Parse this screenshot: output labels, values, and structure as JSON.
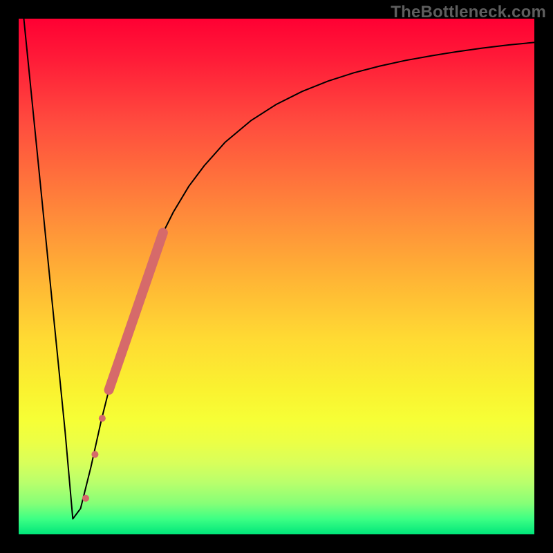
{
  "watermark": "TheBottleneck.com",
  "chart_data": {
    "type": "line",
    "title": "",
    "xlabel": "",
    "ylabel": "",
    "xlim": [
      0,
      100
    ],
    "ylim": [
      0,
      100
    ],
    "grid": false,
    "legend": false,
    "gradient_stops": [
      {
        "pos": 0,
        "color": "#ff0033"
      },
      {
        "pos": 8,
        "color": "#ff1c38"
      },
      {
        "pos": 20,
        "color": "#ff4b3e"
      },
      {
        "pos": 38,
        "color": "#ff8a3a"
      },
      {
        "pos": 50,
        "color": "#ffb335"
      },
      {
        "pos": 62,
        "color": "#ffda33"
      },
      {
        "pos": 72,
        "color": "#faf230"
      },
      {
        "pos": 78,
        "color": "#f6ff36"
      },
      {
        "pos": 82,
        "color": "#ecff45"
      },
      {
        "pos": 86,
        "color": "#d9ff5a"
      },
      {
        "pos": 90,
        "color": "#b9ff6c"
      },
      {
        "pos": 94,
        "color": "#86ff77"
      },
      {
        "pos": 97,
        "color": "#3dff84"
      },
      {
        "pos": 100,
        "color": "#00e67a"
      }
    ],
    "series": [
      {
        "name": "bottleneck-curve",
        "color": "#000000",
        "stroke_width": 2,
        "x": [
          1,
          3,
          5,
          7,
          9,
          10.5,
          12,
          14,
          16,
          18,
          20,
          22,
          24,
          26,
          28,
          30,
          33,
          36,
          40,
          45,
          50,
          55,
          60,
          65,
          70,
          75,
          80,
          85,
          90,
          95,
          100
        ],
        "y": [
          100,
          80,
          60,
          40,
          20,
          3,
          5,
          13,
          22,
          30,
          37,
          43,
          49,
          54,
          58.5,
          62.5,
          67.5,
          71.5,
          76,
          80.2,
          83.4,
          85.9,
          87.9,
          89.5,
          90.8,
          91.9,
          92.8,
          93.6,
          94.3,
          94.9,
          95.4
        ]
      }
    ],
    "highlight_segment": {
      "name": "highlighted-points",
      "color": "#d66a6a",
      "stroke_width": 14,
      "x": [
        17.5,
        28.0
      ],
      "y": [
        28.0,
        58.5
      ]
    },
    "highlight_dots": {
      "name": "highlighted-dots",
      "color": "#d66a6a",
      "radius": 5,
      "points": [
        {
          "x": 13.0,
          "y": 7.0
        },
        {
          "x": 14.8,
          "y": 15.5
        },
        {
          "x": 16.2,
          "y": 22.5
        }
      ]
    },
    "minimum_point": {
      "x": 10.5,
      "y": 3
    }
  }
}
